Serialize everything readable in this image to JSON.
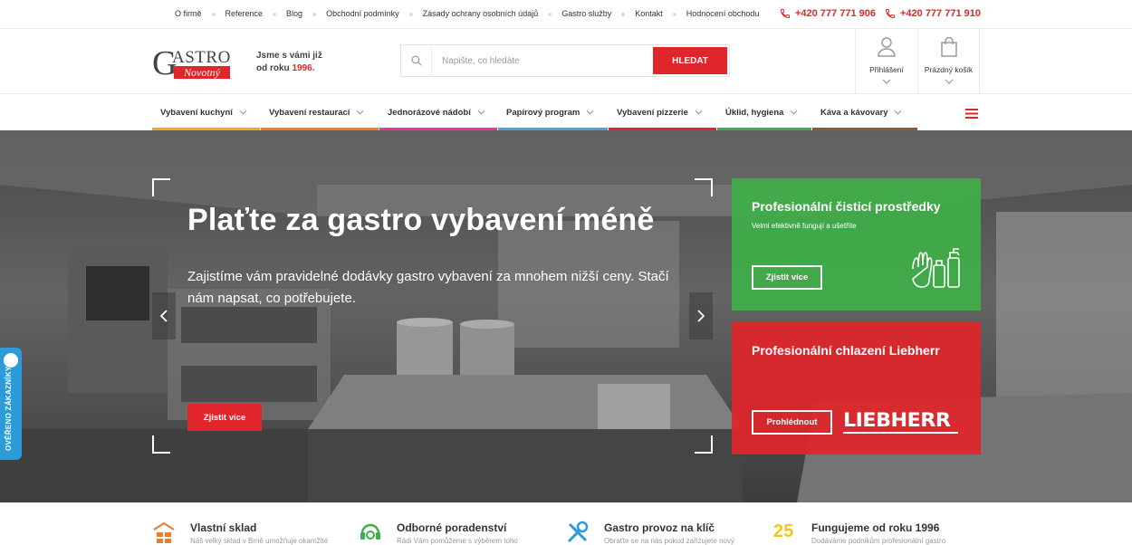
{
  "topbar": {
    "links": [
      "O firmě",
      "Reference",
      "Blog",
      "Obchodní podmínky",
      "Zásady ochrany osobních údajů",
      "Gastro služby",
      "Kontakt",
      "Hodnocení obchodu"
    ],
    "phones": [
      "+420 777 771 906",
      "+420 777 771 910"
    ]
  },
  "header": {
    "logo_top": "ASTRO",
    "logo_g": "G",
    "logo_bottom": "Novotný",
    "tagline_line1": "Jsme s vámi již",
    "tagline_line2_prefix": "od roku",
    "tagline_year": "1996.",
    "search_placeholder": "Napište, co hledáte",
    "search_button": "HLEDAT",
    "login_label": "Přihlášení",
    "cart_label": "Prázdný košík"
  },
  "nav": {
    "items": [
      {
        "label": "Vybavení kuchyní",
        "color": "#f5a623"
      },
      {
        "label": "Vybavení restaurací",
        "color": "#f07c2a"
      },
      {
        "label": "Jednorázové nádobí",
        "color": "#e6399b"
      },
      {
        "label": "Papírový program",
        "color": "#4aa3df"
      },
      {
        "label": "Vybavení pizzerie",
        "color": "#e0262a"
      },
      {
        "label": "Úklid, hygiena",
        "color": "#3fae49"
      },
      {
        "label": "Káva a kávovary",
        "color": "#8a5a3c"
      }
    ]
  },
  "hero": {
    "title": "Plaťte za gastro vybavení méně",
    "text": "Zajistíme vám pravidelné dodávky gastro vybavení za mnohem nižší ceny. Stačí nám napsat, co potřebujete.",
    "cta": "Zjistit více",
    "verified_label": "OVĚŘENO ZÁKAZNÍKY"
  },
  "cards": [
    {
      "title": "Profesionální čisticí prostředky",
      "subtitle": "Velmi efektivně fungují a ušetříte",
      "button": "Zjistit více",
      "color": "#3fae49"
    },
    {
      "title": "Profesionální chlazení Liebherr",
      "subtitle": "",
      "button": "Prohlédnout",
      "brand": "LIEBHERR",
      "color": "#e0262a"
    }
  ],
  "features": [
    {
      "title": "Vlastní sklad",
      "desc": "Náš velký sklad v Brně umožňuje okamžité",
      "icon": "warehouse-icon"
    },
    {
      "title": "Odborné poradenství",
      "desc": "Rádi Vám pomůžeme s výběrem toho",
      "icon": "headset-icon"
    },
    {
      "title": "Gastro provoz na klíč",
      "desc": "Obraťte se na nás pokud zařizujete nový",
      "icon": "tools-icon"
    },
    {
      "title": "Fungujeme od roku 1996",
      "desc": "Dodáváme podnikům profesionální gastro",
      "icon": "years-badge-icon",
      "badge": "25"
    }
  ]
}
